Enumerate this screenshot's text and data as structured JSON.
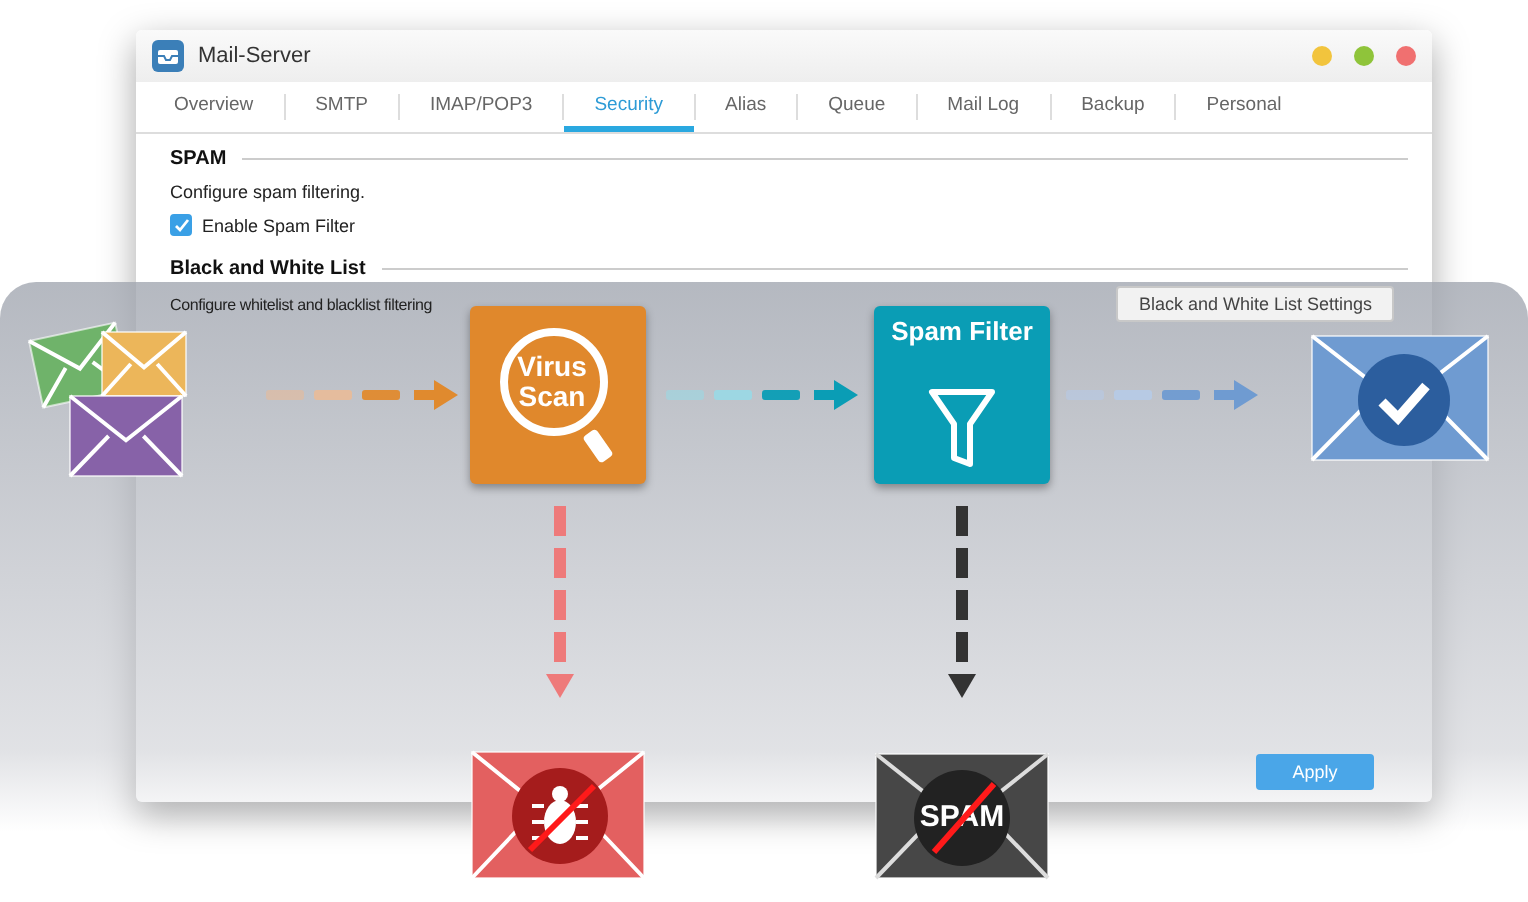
{
  "window": {
    "title": "Mail-Server"
  },
  "tabs": [
    {
      "label": "Overview",
      "selected": false
    },
    {
      "label": "SMTP",
      "selected": false
    },
    {
      "label": "IMAP/POP3",
      "selected": false
    },
    {
      "label": "Security",
      "selected": true
    },
    {
      "label": "Alias",
      "selected": false
    },
    {
      "label": "Queue",
      "selected": false
    },
    {
      "label": "Mail Log",
      "selected": false
    },
    {
      "label": "Backup",
      "selected": false
    },
    {
      "label": "Personal",
      "selected": false
    }
  ],
  "spam_section": {
    "title": "SPAM",
    "description": "Configure spam filtering.",
    "checkbox": {
      "label": "Enable Spam Filter",
      "checked": true
    }
  },
  "list_section": {
    "title": "Black and White List",
    "description": "Configure whitelist and blacklist filtering",
    "button": "Black and White List Settings"
  },
  "apply_button": "Apply",
  "diagram": {
    "stages": [
      {
        "kind": "virus",
        "label": "Virus Scan"
      },
      {
        "kind": "spam",
        "label": "Spam Filter"
      }
    ],
    "rejected_label": "SPAM"
  }
}
